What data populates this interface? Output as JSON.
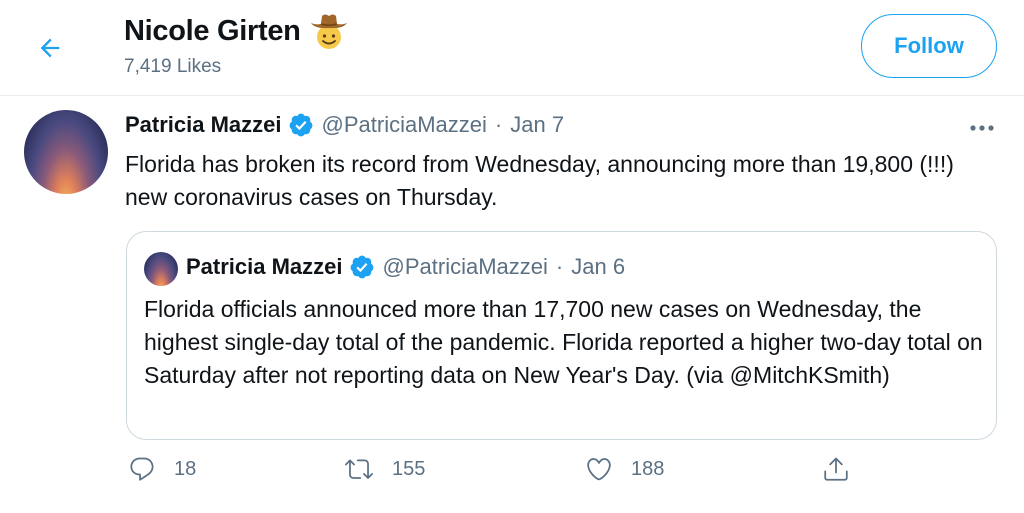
{
  "header": {
    "title": "Nicole Girten",
    "subtitle": "7,419 Likes",
    "follow_label": "Follow"
  },
  "tweet": {
    "name": "Patricia Mazzei",
    "handle": "@PatriciaMazzei",
    "separator": "·",
    "date": "Jan 7",
    "text": "Florida has broken its record from Wednesday, announcing more than 19,800 (!!!) new coronavirus cases on Thursday."
  },
  "quote": {
    "name": "Patricia Mazzei",
    "handle": "@PatriciaMazzei",
    "separator": "·",
    "date": "Jan 6",
    "text": "Florida officials announced more than 17,700 new cases on Wednesday, the highest single-day total of the pandemic. Florida reported a higher two-day total on Saturday after not reporting data on New Year's Day. (via @MitchKSmith)"
  },
  "actions": {
    "replies": "18",
    "retweets": "155",
    "likes": "188"
  },
  "icons": {
    "back": "arrow-left-icon",
    "emoji": "cowboy-emoji-icon",
    "verified": "verified-badge-icon",
    "more": "more-dots-icon",
    "reply": "reply-icon",
    "retweet": "retweet-icon",
    "like": "heart-icon",
    "share": "share-icon"
  },
  "colors": {
    "accent": "#1da1f2",
    "muted": "#5b7083",
    "text": "#0f1419",
    "border": "#cfd9de"
  }
}
